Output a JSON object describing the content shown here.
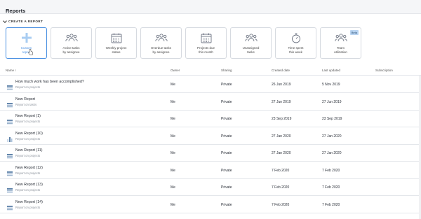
{
  "header": {
    "title": "Reports"
  },
  "section": {
    "label": "CREATE A REPORT"
  },
  "tiles": [
    {
      "label": "Custom\nreport",
      "icon": "plus-icon"
    },
    {
      "label": "Active tasks\nby assignee",
      "icon": "people-icon"
    },
    {
      "label": "Weekly project\nstatus",
      "icon": "calendar-icon"
    },
    {
      "label": "Overdue tasks\nby assignee",
      "icon": "people-icon"
    },
    {
      "label": "Projects due\nthis month",
      "icon": "calendar-icon"
    },
    {
      "label": "Unassigned\ntasks",
      "icon": "people-icon"
    },
    {
      "label": "Time spent\nthis week",
      "icon": "stopwatch-icon"
    },
    {
      "label": "Team\nutilization",
      "icon": "people-icon",
      "badge": "Beta"
    }
  ],
  "columns": {
    "name": "Name ↑",
    "owner": "Owner",
    "sharing": "Sharing",
    "created": "Created date",
    "updated": "Last updated",
    "subscription": "Subscription"
  },
  "rows": [
    {
      "name": "How much work has been accomplished?",
      "sub": "Report on projects",
      "owner": "Me",
      "sharing": "Private",
      "created": "26 Jun 2019",
      "updated": "5 Nov 2019",
      "icon": "table-icon"
    },
    {
      "name": "New Report",
      "sub": "Report on tasks",
      "owner": "Me",
      "sharing": "Private",
      "created": "27 Jun 2019",
      "updated": "27 Jun 2019",
      "icon": "table-icon"
    },
    {
      "name": "New Report (1)",
      "sub": "Report on projects",
      "owner": "Me",
      "sharing": "Private",
      "created": "23 Sep 2019",
      "updated": "23 Sep 2019",
      "icon": "table-icon"
    },
    {
      "name": "New Report (10)",
      "sub": "Report on projects",
      "owner": "Me",
      "sharing": "Private",
      "created": "27 Jan 2020",
      "updated": "27 Jan 2020",
      "icon": "bar-chart-icon"
    },
    {
      "name": "New Report (11)",
      "sub": "Report on projects",
      "owner": "Me",
      "sharing": "Private",
      "created": "27 Jan 2020",
      "updated": "27 Jan 2020",
      "icon": "table-icon"
    },
    {
      "name": "New Report (12)",
      "sub": "Report on projects",
      "owner": "Me",
      "sharing": "Private",
      "created": "7 Feb 2020",
      "updated": "7 Feb 2020",
      "icon": "table-icon"
    },
    {
      "name": "New Report (13)",
      "sub": "Report on projects",
      "owner": "Me",
      "sharing": "Private",
      "created": "7 Feb 2020",
      "updated": "7 Feb 2020",
      "icon": "table-icon"
    },
    {
      "name": "New Report (14)",
      "sub": "Report on projects",
      "owner": "Me",
      "sharing": "Private",
      "created": "7 Feb 2020",
      "updated": "7 Feb 2020",
      "icon": "table-icon"
    }
  ],
  "colors": {
    "accent": "#4a90e2",
    "icon": "#6b7280",
    "reportIcon": "#5b7fa6",
    "border": "#e4e7eb"
  }
}
